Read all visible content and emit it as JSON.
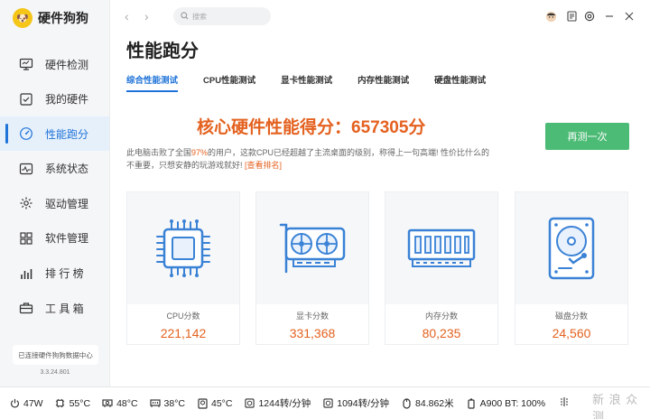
{
  "app": {
    "name": "硬件狗狗",
    "version": "3.3.24.801",
    "connect_text": "已连接硬件狗狗数据中心"
  },
  "sidebar": {
    "items": [
      {
        "label": "硬件检测",
        "icon": "monitor-icon"
      },
      {
        "label": "我的硬件",
        "icon": "checkbox-icon"
      },
      {
        "label": "性能跑分",
        "icon": "speedometer-icon"
      },
      {
        "label": "系统状态",
        "icon": "pulse-icon"
      },
      {
        "label": "驱动管理",
        "icon": "gear-icon"
      },
      {
        "label": "软件管理",
        "icon": "apps-icon"
      },
      {
        "label": "排 行 榜",
        "icon": "bar-chart-icon"
      },
      {
        "label": "工 具 箱",
        "icon": "toolbox-icon"
      }
    ],
    "active_index": 2
  },
  "topbar": {
    "search_placeholder": "搜索"
  },
  "page": {
    "title": "性能跑分",
    "tabs": [
      "综合性能测试",
      "CPU性能测试",
      "显卡性能测试",
      "内存性能测试",
      "硬盘性能测试"
    ],
    "score_title": "核心硬件性能得分：657305分",
    "desc_line1_a": "此电脑击败了全国",
    "desc_pct": "97%",
    "desc_line1_b": "的用户，这款CPU已经超越了主流桌面的级别，称得上一句高端! 性价比什么的",
    "desc_line2": "不重要，只想安静的玩游戏就好!",
    "rank_link": "[查看排名]",
    "retest_button": "再测一次"
  },
  "scores": [
    {
      "label": "CPU分数",
      "value": "221,142",
      "icon": "cpu-icon"
    },
    {
      "label": "显卡分数",
      "value": "331,368",
      "icon": "gpu-icon"
    },
    {
      "label": "内存分数",
      "value": "80,235",
      "icon": "ram-icon"
    },
    {
      "label": "磁盘分数",
      "value": "24,560",
      "icon": "hdd-icon"
    }
  ],
  "status": [
    {
      "value": "47W",
      "icon": "power-icon"
    },
    {
      "value": "55°C",
      "icon": "cpu-temp-icon"
    },
    {
      "value": "48°C",
      "icon": "gpu-temp-icon"
    },
    {
      "value": "38°C",
      "icon": "ram-temp-icon"
    },
    {
      "value": "45°C",
      "icon": "disk-temp-icon"
    },
    {
      "value": "1244转/分钟",
      "icon": "fan-icon"
    },
    {
      "value": "1094转/分钟",
      "icon": "fan-icon"
    },
    {
      "value": "84.862米",
      "icon": "mouse-icon"
    },
    {
      "value": "A900 BT: 100%",
      "icon": "battery-icon"
    }
  ],
  "watermark": "新 浪 众 测",
  "colors": {
    "accent": "#1f73d8",
    "score": "#e4611f",
    "retest": "#4cbb75",
    "icon_blue": "#3a82d6"
  }
}
